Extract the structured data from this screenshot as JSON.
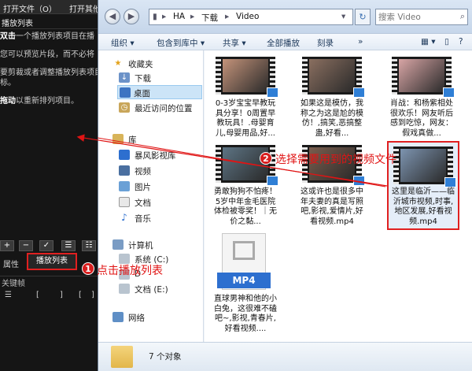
{
  "left_panel": {
    "menu": [
      "打开文件（O）",
      "打开其他"
    ],
    "panel_title": "播放列表",
    "help": [
      {
        "bold": "双击",
        "text": "一个播放列表项目在播"
      },
      {
        "bold": "",
        "text": "您可以预览片段，而不必将"
      },
      {
        "bold": "",
        "text": "要剪裁或者调整播放列表项目"
      },
      {
        "bold": "",
        "text": "标。"
      },
      {
        "bold": "拖动",
        "text": "以重新排列项目。"
      }
    ],
    "toolbar_buttons": [
      "+",
      "−",
      "✓",
      "☰",
      "☷"
    ],
    "tab_properties": "属性",
    "tab_playlist": "播放列表",
    "keyframes_label": "关键帧",
    "keyframe_bar": [
      "☰",
      "[",
      "]",
      "[",
      "]"
    ]
  },
  "explorer": {
    "breadcrumb": [
      "HA",
      "下载",
      "Video"
    ],
    "search_placeholder": "搜索 Video",
    "commands": [
      "组织 ▾",
      "包含到库中 ▾",
      "共享 ▾",
      "全部播放",
      "刻录",
      "»"
    ],
    "nav": {
      "favorites": "收藏夹",
      "downloads": "下载",
      "desktop": "桌面",
      "recent": "最近访问的位置",
      "libraries": "库",
      "storm": "暴风影视库",
      "videos": "视频",
      "pictures": "图片",
      "documents": "文档",
      "music": "音乐",
      "computer": "计算机",
      "drive_c": "系统 (C:)",
      "drive_d": "D",
      "drive_e": "文档 (E:)",
      "network": "网络"
    },
    "files": [
      {
        "name": "0-3岁宝宝早教玩具分享！0周置早教玩具！.母婴育儿,母婴用品,好...",
        "color": "#c4937a"
      },
      {
        "name": "如果这是模仿，我称之为这是尬的模仿！,搞笑,恶搞整蛊,好看...",
        "color": "#8a6f60"
      },
      {
        "name": "肖战：和杨紫相处很欢乐！网友听后感到吃惊，网友：假戏真做...",
        "color": "#d8a5a5"
      },
      {
        "name": "勇敢狗狗不怕疼！5岁中年金毛医院体检被零奖！｜无价之黏...",
        "color": "#5d7484"
      },
      {
        "name": "这或许也是很多中年夫妻的真是写照吧,影视,爱情片,好看视频.mp4",
        "color": "#7a5e4e"
      },
      {
        "name": "这里是临沂——临沂城市视频,时事,地区发展,好看视频.mp4",
        "color": "#7d94b0"
      },
      {
        "name": "直球男神和他的小白兔，这很难不磕吧~,影视,青春片,好看视频...."
      }
    ],
    "mp4_label": "MP4",
    "status_count": "7 个对象"
  },
  "annotations": {
    "step1_number": "1",
    "step1_text": "点击播放列表",
    "step2_number": "2",
    "step2_text": "选择需要用到的视频文件"
  }
}
